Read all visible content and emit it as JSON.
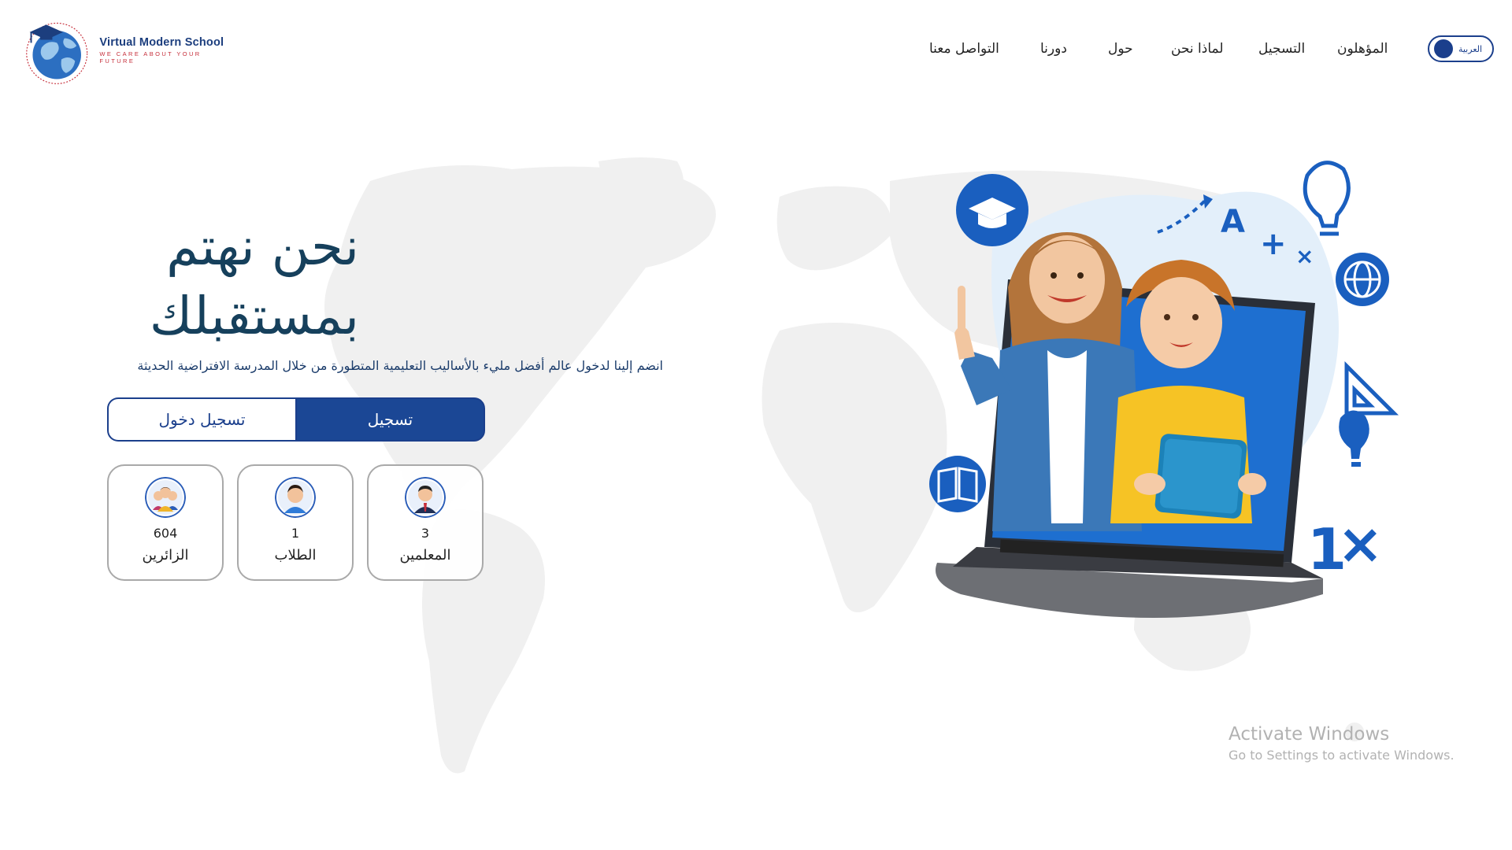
{
  "logo": {
    "name": "Virtual Modern School",
    "tagline": "WE CARE ABOUT YOUR FUTURE",
    "ring_text": "Virtual Modern School"
  },
  "language": {
    "label": "العربية"
  },
  "nav": {
    "items": [
      {
        "label": "المؤهلون"
      },
      {
        "label": "التسجيل"
      },
      {
        "label": "لماذا نحن"
      },
      {
        "label": "حول"
      },
      {
        "label": "دورنا"
      },
      {
        "label": "التواصل معنا"
      }
    ]
  },
  "hero": {
    "title_line1": "نحن نهتم",
    "title_line2": "بمستقبلك",
    "subtitle": "انضم إلينا لدخول عالم أفضل مليء بالأساليب التعليمية المتطورة من خلال المدرسة الافتراضية الحديثة",
    "register_label": "تسجيل",
    "login_label": "تسجيل دخول"
  },
  "stats": [
    {
      "value": "604",
      "label": "الزائرين",
      "icon": "visitors-icon"
    },
    {
      "value": "1",
      "label": "الطلاب",
      "icon": "student-icon"
    },
    {
      "value": "3",
      "label": "المعلمين",
      "icon": "teacher-icon"
    }
  ],
  "watermark": {
    "title": "Activate Windows",
    "subtitle": "Go to Settings to activate Windows."
  },
  "colors": {
    "primary": "#1b4795",
    "title": "#16405c",
    "icon_blue": "#1a5fbf",
    "map": "#efefef"
  }
}
